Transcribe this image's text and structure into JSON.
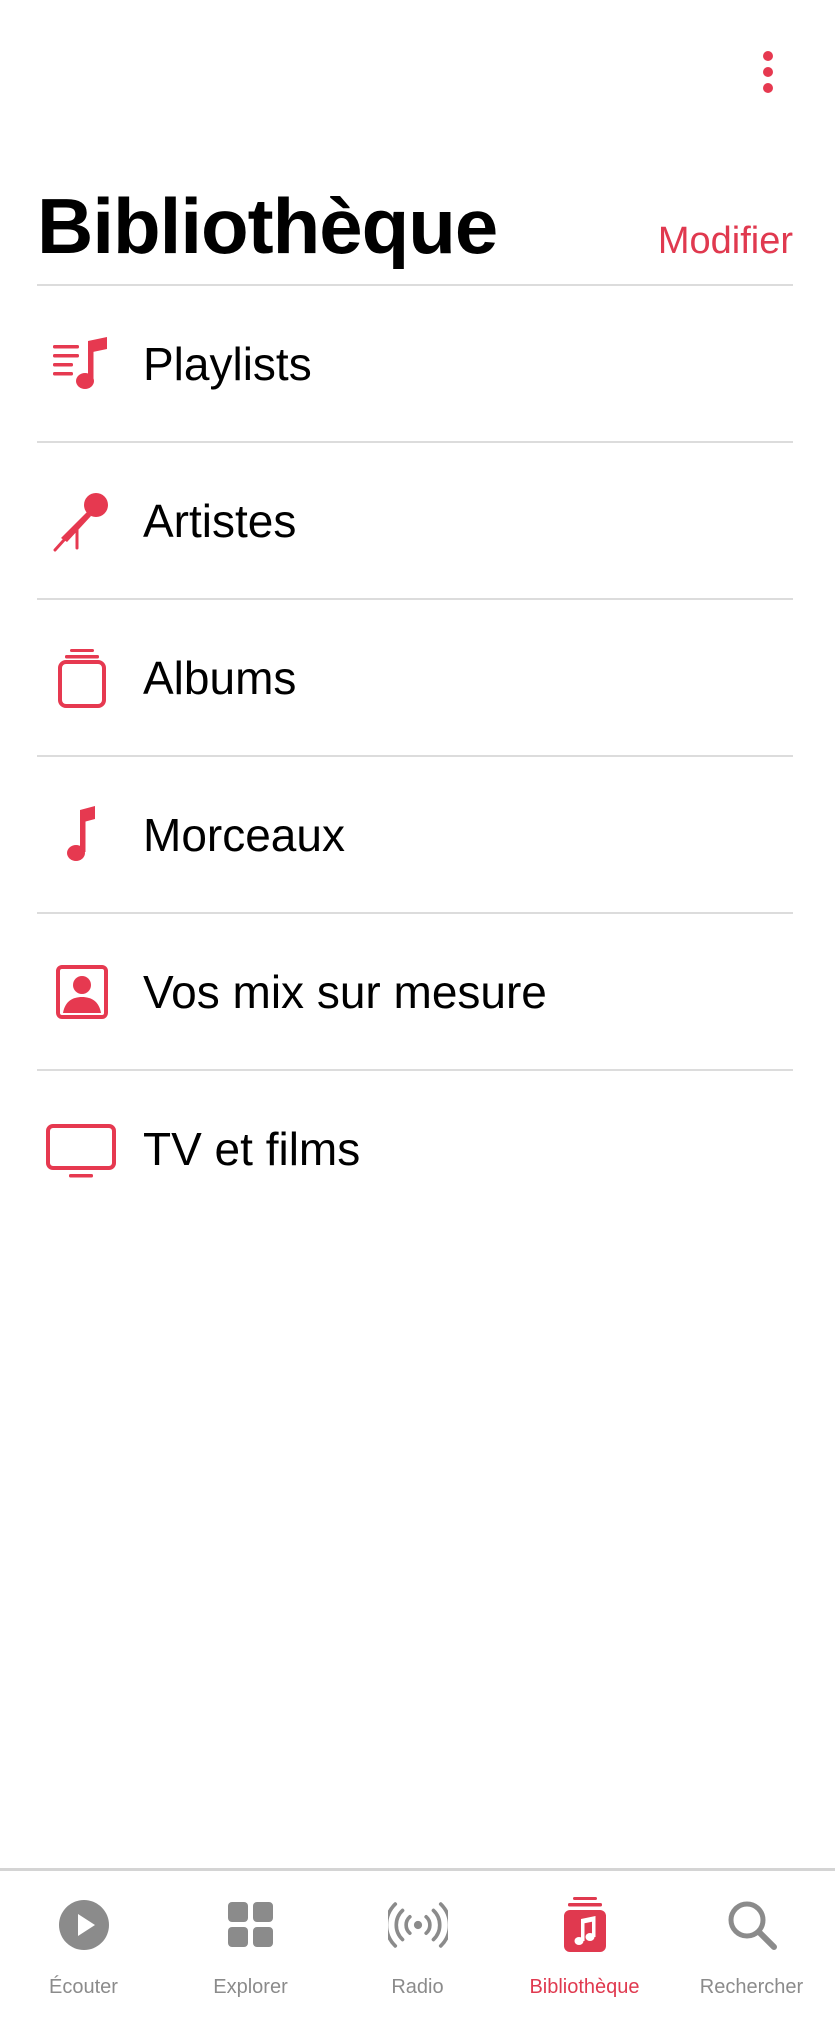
{
  "header": {
    "title": "Bibliothèque",
    "edit_label": "Modifier"
  },
  "menu": {
    "icon": "more-vertical-icon"
  },
  "library_items": [
    {
      "label": "Playlists",
      "icon": "playlist-icon"
    },
    {
      "label": "Artistes",
      "icon": "microphone-icon"
    },
    {
      "label": "Albums",
      "icon": "album-stack-icon"
    },
    {
      "label": "Morceaux",
      "icon": "music-note-icon"
    },
    {
      "label": "Vos mix sur mesure",
      "icon": "person-square-icon"
    },
    {
      "label": "TV et films",
      "icon": "tv-icon"
    }
  ],
  "tab_bar": {
    "tabs": [
      {
        "label": "Écouter",
        "icon": "play-circle-icon",
        "active": false
      },
      {
        "label": "Explorer",
        "icon": "grid-icon",
        "active": false
      },
      {
        "label": "Radio",
        "icon": "radio-waves-icon",
        "active": false
      },
      {
        "label": "Bibliothèque",
        "icon": "library-icon",
        "active": true
      },
      {
        "label": "Rechercher",
        "icon": "search-icon",
        "active": false
      }
    ]
  },
  "colors": {
    "accent": "#e0394f",
    "inactive": "#8b8b8b",
    "divider": "#dcdcdc"
  }
}
